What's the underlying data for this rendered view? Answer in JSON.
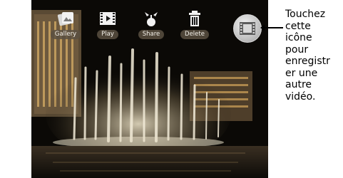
{
  "toolbar": {
    "items": [
      {
        "label": "Gallery",
        "icon": "gallery-icon"
      },
      {
        "label": "Play",
        "icon": "play-icon"
      },
      {
        "label": "Share",
        "icon": "share-icon"
      },
      {
        "label": "Delete",
        "icon": "delete-icon"
      }
    ]
  },
  "record_button": {
    "icon": "film-icon"
  },
  "callout": {
    "lines": [
      "Touchez",
      "cette",
      "icône",
      "pour",
      "enregistr",
      "er une",
      "autre",
      "vidéo."
    ]
  }
}
